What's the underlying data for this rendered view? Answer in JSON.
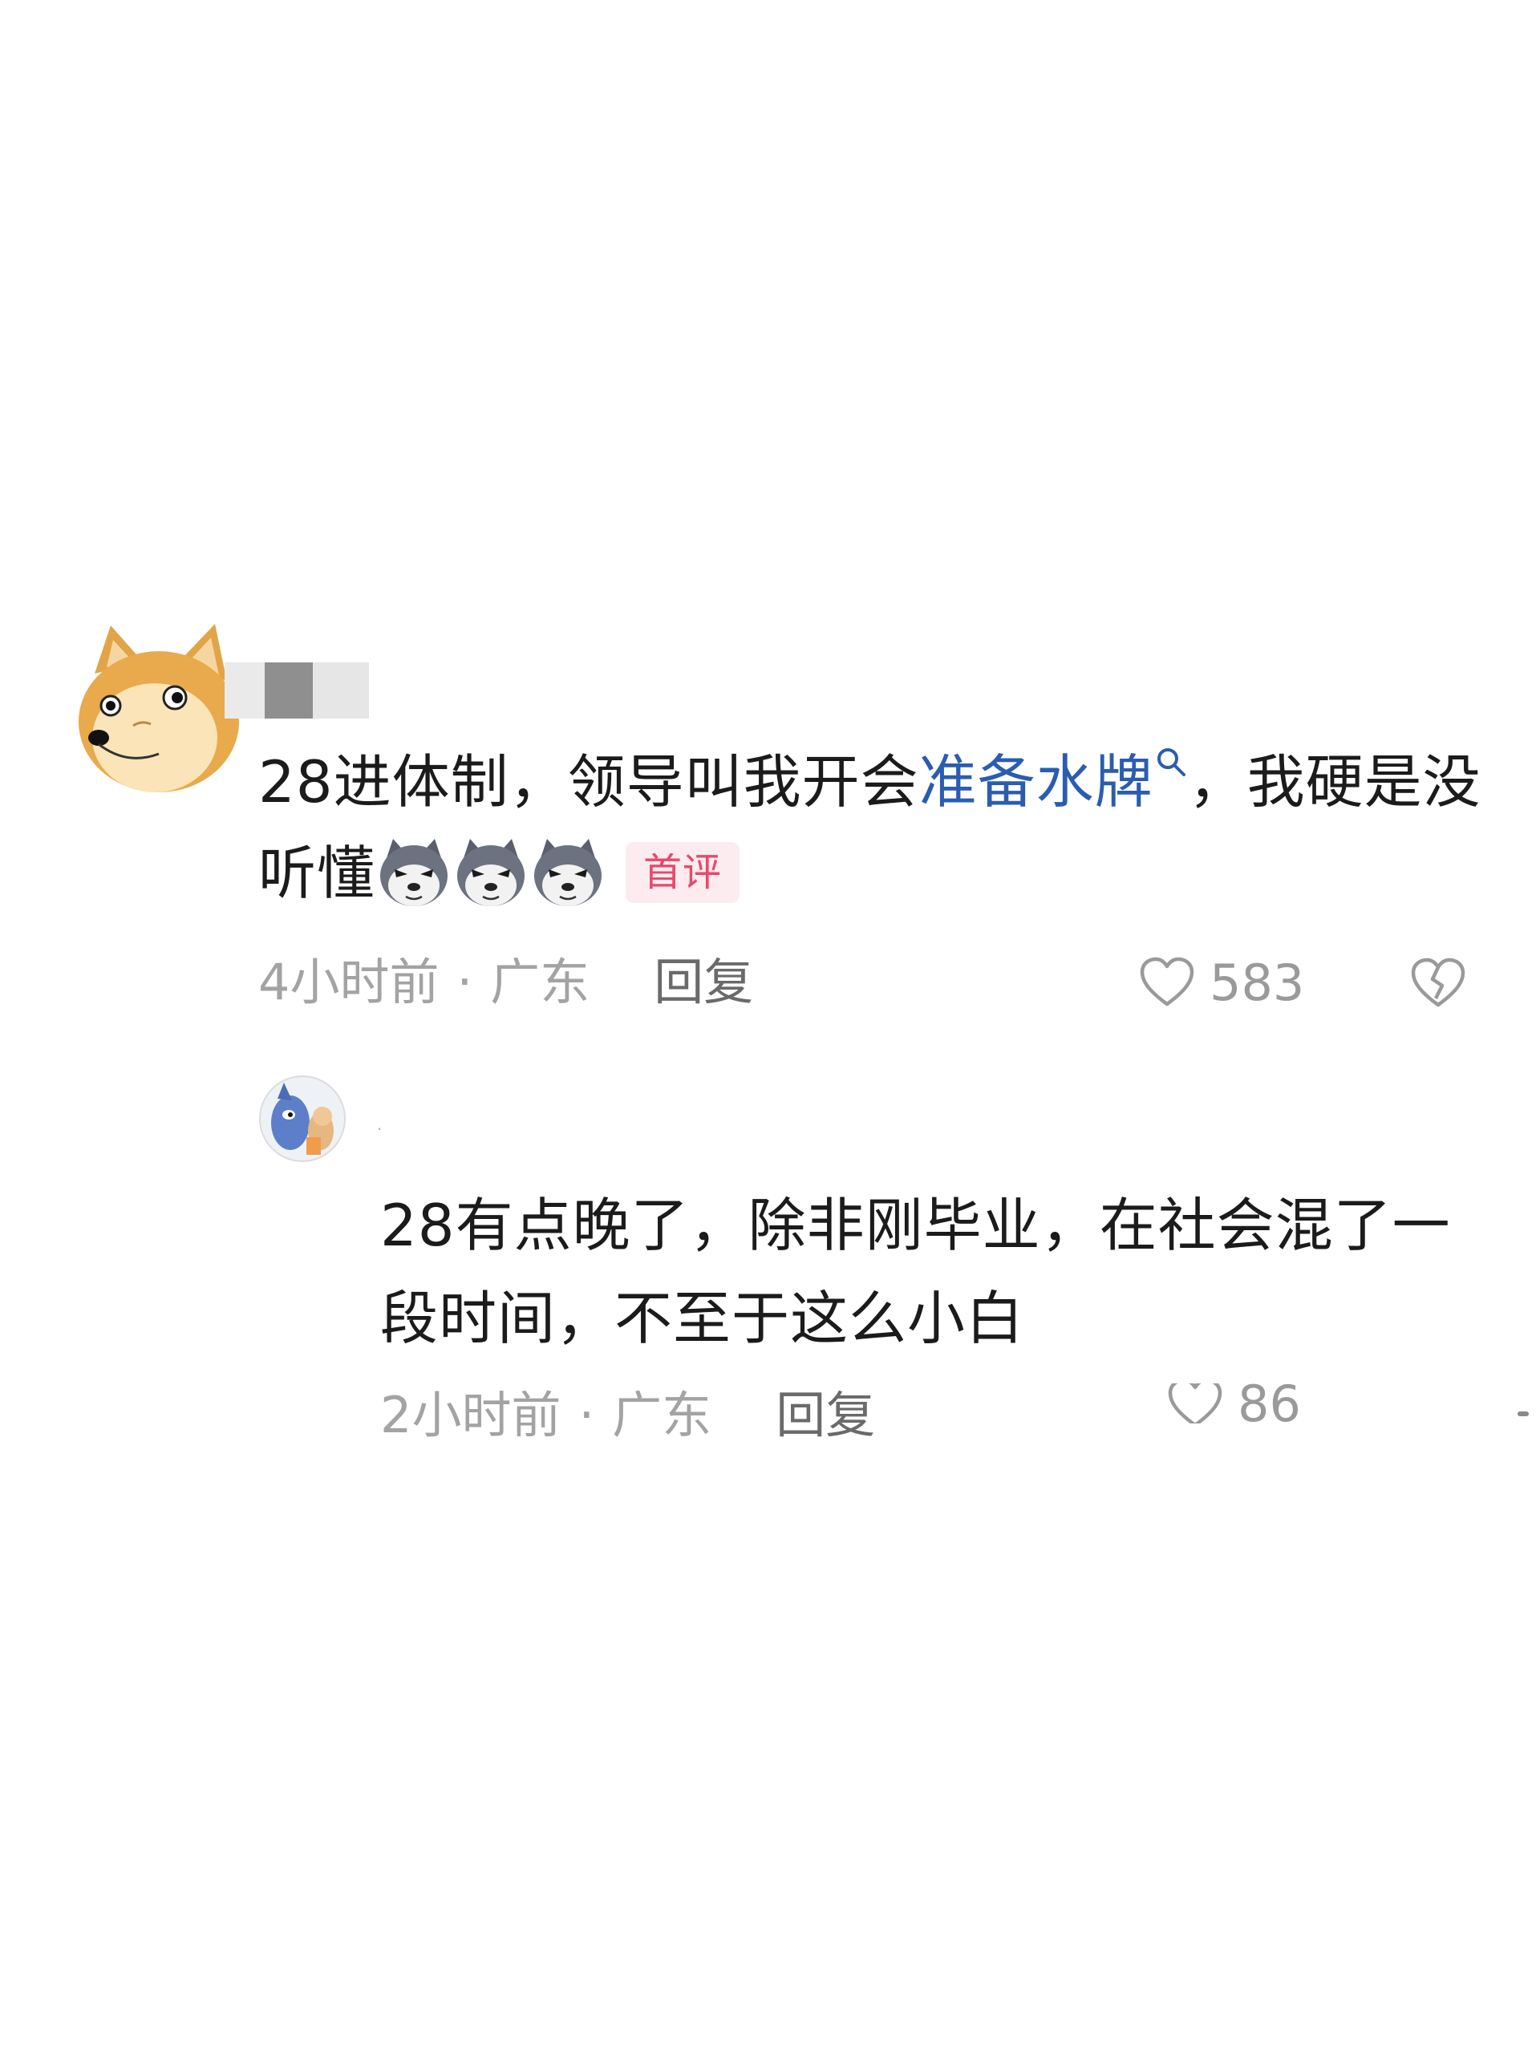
{
  "main_comment": {
    "text_before": "28进体制，领导叫我开会",
    "keyword": "准备水牌",
    "text_after": "，我硬是没听懂",
    "badge": "首评",
    "time": "4小时前",
    "separator": "·",
    "location": "广东",
    "reply_label": "回复",
    "like_count": "583",
    "icons": [
      "doge-avatar",
      "search-icon",
      "wolf-emoji",
      "heart-outline-icon",
      "broken-heart-icon"
    ]
  },
  "reply_comment": {
    "username": ".",
    "text": "28有点晚了，除非刚毕业，在社会混了一段时间，不至于这么小白",
    "time": "2小时前",
    "separator": "·",
    "location": "广东",
    "reply_label": "回复",
    "like_count_partial": "86",
    "icons": [
      "cartoon-avatar",
      "heart-outline-icon"
    ]
  },
  "colors": {
    "text": "#1b1b1b",
    "keyword_blue": "#2a5db0",
    "meta_gray": "#a3a3a3",
    "badge_red": "#e8486a",
    "badge_bg": "#fdecef"
  }
}
